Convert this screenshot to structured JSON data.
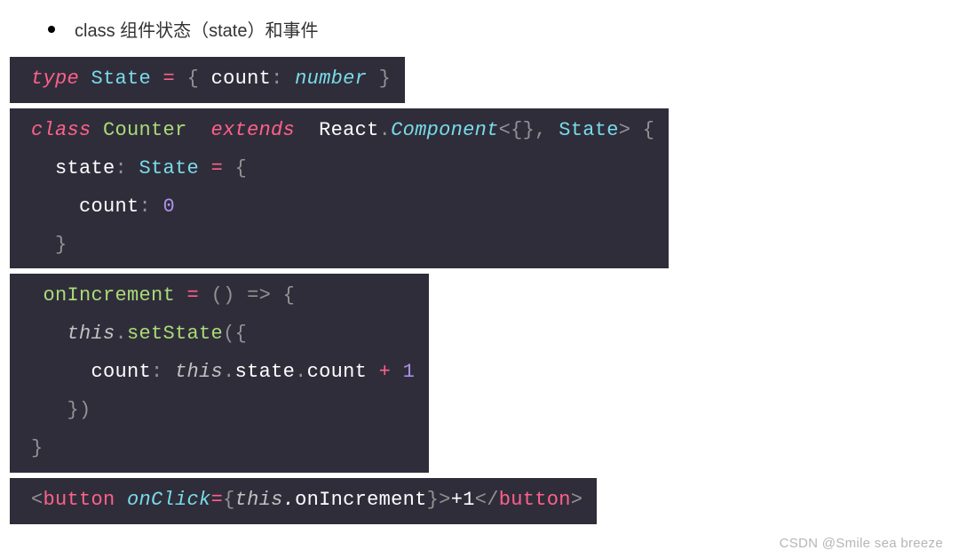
{
  "heading": "class 组件状态（state）和事件",
  "watermark": "CSDN @Smile sea breeze",
  "code1": {
    "type_kw": "type",
    "state_name": "State",
    "eq": " = ",
    "lbrace": "{",
    "count_key": " count",
    "colon": ": ",
    "number_type": "number",
    "rbrace": " }"
  },
  "code2": {
    "class_kw": "class",
    "class_name": " Counter ",
    "extends_kw": " extends ",
    "react": " React",
    "dot": ".",
    "component": "Component",
    "generic_open": "<",
    "empty_obj": "{}",
    "comma": ", ",
    "state_type": "State",
    "generic_close": ">",
    "space_brace": " {",
    "line2_indent": "  ",
    "state_prop": "state",
    "colon": ": ",
    "state_type2": "State",
    "eq": " = ",
    "lbrace2": "{",
    "line3_indent": "    ",
    "count_key": "count",
    "colon2": ": ",
    "zero": "0",
    "line4_indent": "  ",
    "rbrace2": "}"
  },
  "code3": {
    "indent1": " ",
    "onIncrement": "onIncrement",
    "eq": " = ",
    "parens": "()",
    "arrow": " => ",
    "lbrace": "{",
    "indent2": "   ",
    "this1": "this",
    "dot": ".",
    "setState": "setState",
    "lparen": "(",
    "lbrace2": "{",
    "indent3": "     ",
    "count_key": "count",
    "colon": ": ",
    "this2": "this",
    "state_prop": "state",
    "count_prop": "count",
    "plus": " + ",
    "one": "1",
    "indent4": "   ",
    "rbrace2": "}",
    "rparen": ")",
    "rbrace": "}"
  },
  "code4": {
    "lt": "<",
    "button_open": "button",
    "space": " ",
    "onClick": "onClick",
    "eq": "=",
    "lbrace": "{",
    "this": "this",
    "dot": ".",
    "onIncrement": "onIncrement",
    "rbrace": "}",
    "gt": ">",
    "text": "+1",
    "lt_close": "</",
    "button_close": "button",
    "gt2": ">"
  }
}
